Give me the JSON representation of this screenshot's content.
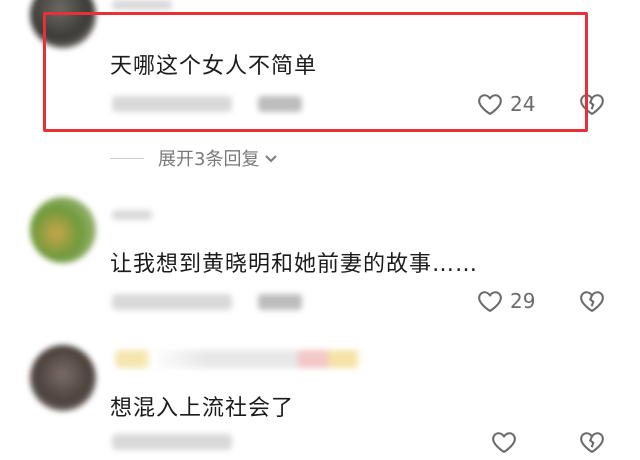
{
  "comments": [
    {
      "text": "天哪这个女人不简单",
      "likes": "24",
      "replies_label": "展开3条回复"
    },
    {
      "text": "让我想到黄晓明和她前妻的故事……",
      "likes": "29"
    },
    {
      "text": "想混入上流社会了",
      "likes": ""
    }
  ],
  "colors": {
    "highlight": "#e8303a",
    "text": "#1b1b1b",
    "meta": "#6b6b6b"
  },
  "icons": {
    "like": "heart-outline-icon",
    "dislike": "broken-heart-icon",
    "expand": "chevron-down-icon"
  }
}
